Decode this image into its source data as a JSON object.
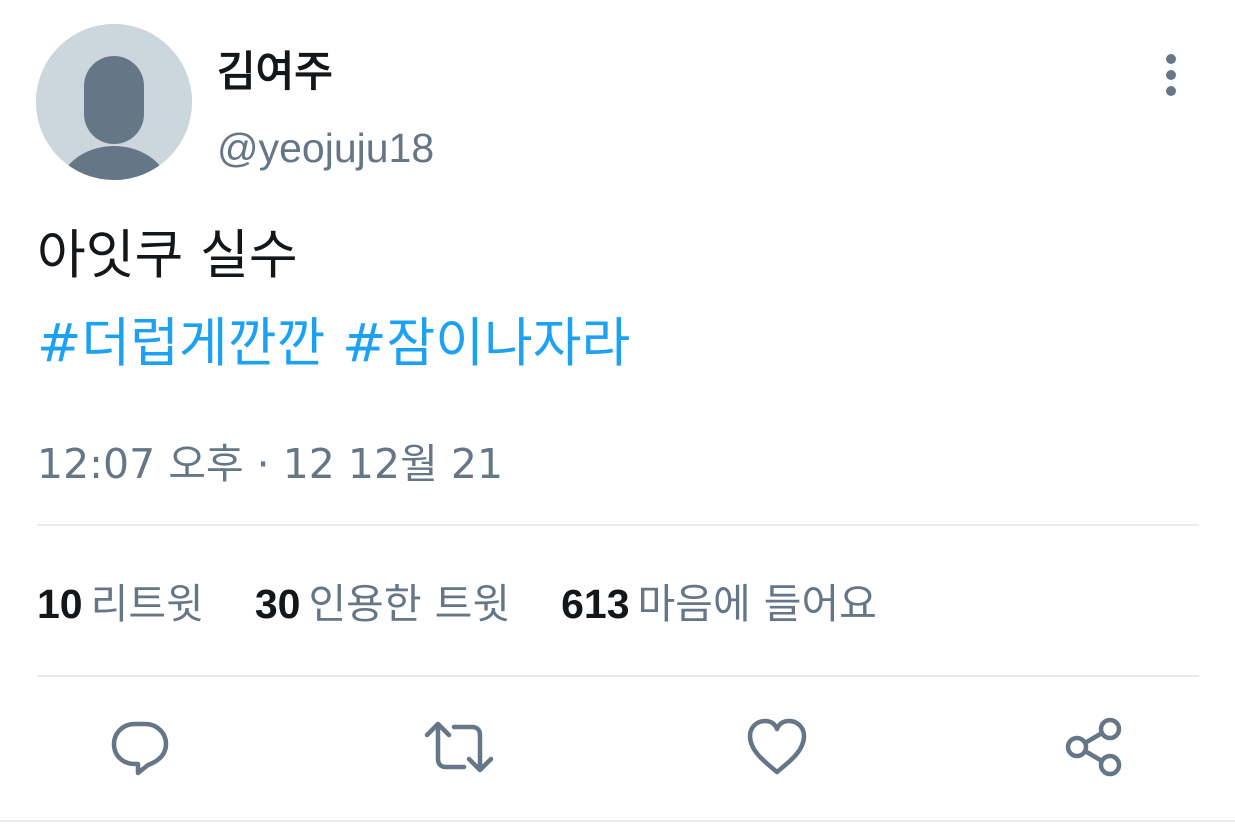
{
  "user": {
    "display_name": "김여주",
    "handle": "@yeojuju18",
    "avatar_icon": "default-avatar-icon"
  },
  "menu": {
    "icon": "more-vertical-icon"
  },
  "tweet": {
    "text": "아잇쿠 실수",
    "hashtags": [
      "#더럽게깐깐",
      "#잠이나자라"
    ],
    "timestamp": "12:07 오후 · 12 12월 21"
  },
  "stats": {
    "retweets": {
      "count": "10",
      "label": "리트윗"
    },
    "quotes": {
      "count": "30",
      "label": "인용한 트윗"
    },
    "likes": {
      "count": "613",
      "label": "마음에 들어요"
    }
  },
  "actions": [
    {
      "name": "reply",
      "icon": "reply-icon"
    },
    {
      "name": "retweet",
      "icon": "retweet-icon"
    },
    {
      "name": "like",
      "icon": "heart-icon"
    },
    {
      "name": "share",
      "icon": "share-icon"
    }
  ],
  "colors": {
    "link": "#1da1f2",
    "secondary_text": "#657786",
    "icon": "#657786",
    "avatar_bg": "#ccd6dd",
    "divider": "#e6ecf0"
  }
}
